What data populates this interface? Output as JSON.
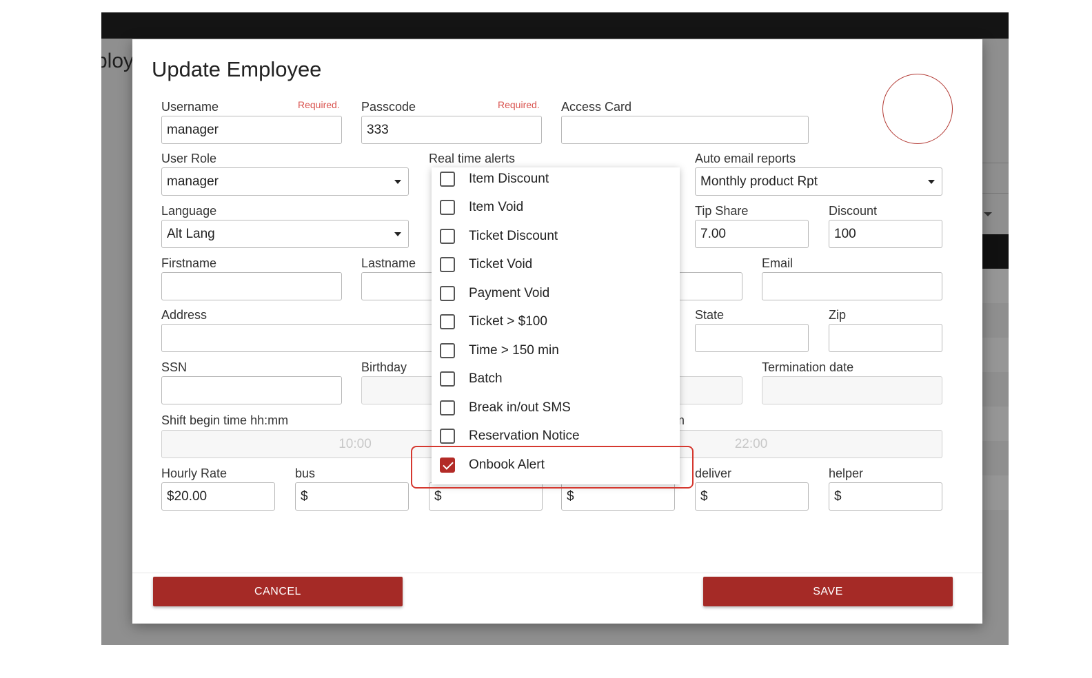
{
  "background": {
    "page_title_fragment": "ploy"
  },
  "modal": {
    "title": "Update Employee",
    "username": {
      "label": "Username",
      "required": "Required.",
      "value": "manager"
    },
    "passcode": {
      "label": "Passcode",
      "required": "Required.",
      "value": "333"
    },
    "access_card": {
      "label": "Access Card",
      "value": ""
    },
    "user_role": {
      "label": "User Role",
      "value": "manager"
    },
    "real_time_alerts": {
      "label": "Real time alerts",
      "options": [
        {
          "label": "Item Discount",
          "checked": false
        },
        {
          "label": "Item Void",
          "checked": false
        },
        {
          "label": "Ticket Discount",
          "checked": false
        },
        {
          "label": "Ticket Void",
          "checked": false
        },
        {
          "label": "Payment Void",
          "checked": false
        },
        {
          "label": "Ticket > $100",
          "checked": false
        },
        {
          "label": "Time > 150 min",
          "checked": false
        },
        {
          "label": "Batch",
          "checked": false
        },
        {
          "label": "Break in/out SMS",
          "checked": false
        },
        {
          "label": "Reservation Notice",
          "checked": false
        },
        {
          "label": "Onbook Alert",
          "checked": true
        }
      ]
    },
    "auto_email_reports": {
      "label": "Auto email reports",
      "value": "Monthly product Rpt"
    },
    "language": {
      "label": "Language",
      "value": "Alt Lang"
    },
    "tip_share": {
      "label": "Tip Share",
      "value": "7.00"
    },
    "discount": {
      "label": "Discount",
      "value": "100"
    },
    "firstname": {
      "label": "Firstname",
      "value": ""
    },
    "lastname": {
      "label": "Lastname",
      "value": ""
    },
    "email": {
      "label": "Email",
      "value": ""
    },
    "address": {
      "label": "Address",
      "value": ""
    },
    "state": {
      "label": "State",
      "value": ""
    },
    "zip": {
      "label": "Zip",
      "value": ""
    },
    "ssn": {
      "label": "SSN",
      "value": ""
    },
    "birthday": {
      "label": "Birthday",
      "value": ""
    },
    "termination_date": {
      "label": "Termination date",
      "value": ""
    },
    "shift_begin": {
      "label": "Shift begin time hh:mm",
      "value": "10:00"
    },
    "shift_end": {
      "label_fragment": "m",
      "value": "22:00"
    },
    "hourly_rate": {
      "label": "Hourly Rate",
      "value": "$20.00"
    },
    "bus": {
      "label": "bus",
      "value": "$"
    },
    "rate_col3": {
      "value": "$"
    },
    "rate_col4": {
      "value": "$"
    },
    "deliver": {
      "label": "deliver",
      "value": "$"
    },
    "helper": {
      "label": "helper",
      "value": "$"
    },
    "cancel_label": "CANCEL",
    "save_label": "SAVE"
  },
  "colors": {
    "accent": "#a52a26",
    "required": "#d9534f",
    "highlight": "#d5382f"
  }
}
